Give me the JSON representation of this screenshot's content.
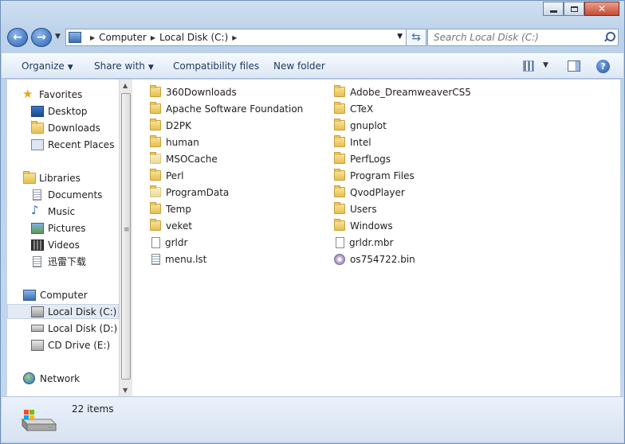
{
  "window": {
    "title": "Local Disk (C:)",
    "controls": [
      "minimize",
      "maximize",
      "close"
    ]
  },
  "navigation": {
    "back_icon": "back-arrow-icon",
    "forward_icon": "forward-arrow-icon",
    "breadcrumbs": [
      "Computer",
      "Local Disk (C:)"
    ],
    "search_placeholder": "Search Local Disk (C:)"
  },
  "toolbar": {
    "organize": "Organize",
    "share_with": "Share with",
    "compatibility_files": "Compatibility files",
    "new_folder": "New folder"
  },
  "sidebar": {
    "favorites": {
      "label": "Favorites",
      "items": [
        "Desktop",
        "Downloads",
        "Recent Places"
      ]
    },
    "libraries": {
      "label": "Libraries",
      "items": [
        "Documents",
        "Music",
        "Pictures",
        "Videos",
        "迅雷下载"
      ]
    },
    "computer": {
      "label": "Computer",
      "items": [
        "Local Disk (C:)",
        "Local Disk (D:)",
        "CD Drive (E:)"
      ],
      "selected": "Local Disk (C:)"
    },
    "network": {
      "label": "Network"
    }
  },
  "files": {
    "column1": [
      {
        "name": "360Downloads",
        "type": "folder"
      },
      {
        "name": "Apache Software Foundation",
        "type": "folder"
      },
      {
        "name": "D2PK",
        "type": "folder"
      },
      {
        "name": "human",
        "type": "folder"
      },
      {
        "name": "MSOCache",
        "type": "folder-hidden"
      },
      {
        "name": "Perl",
        "type": "folder"
      },
      {
        "name": "ProgramData",
        "type": "folder-hidden"
      },
      {
        "name": "Temp",
        "type": "folder"
      },
      {
        "name": "veket",
        "type": "folder"
      },
      {
        "name": "grldr",
        "type": "file"
      },
      {
        "name": "menu.lst",
        "type": "text-file"
      }
    ],
    "column2": [
      {
        "name": "Adobe_DreamweaverCS5",
        "type": "folder"
      },
      {
        "name": "CTeX",
        "type": "folder"
      },
      {
        "name": "gnuplot",
        "type": "folder"
      },
      {
        "name": "Intel",
        "type": "folder"
      },
      {
        "name": "PerfLogs",
        "type": "folder"
      },
      {
        "name": "Program Files",
        "type": "folder"
      },
      {
        "name": "QvodPlayer",
        "type": "folder"
      },
      {
        "name": "Users",
        "type": "folder"
      },
      {
        "name": "Windows",
        "type": "folder"
      },
      {
        "name": "grldr.mbr",
        "type": "file"
      },
      {
        "name": "os754722.bin",
        "type": "disc-image"
      }
    ]
  },
  "status": {
    "item_count": "22 items"
  }
}
